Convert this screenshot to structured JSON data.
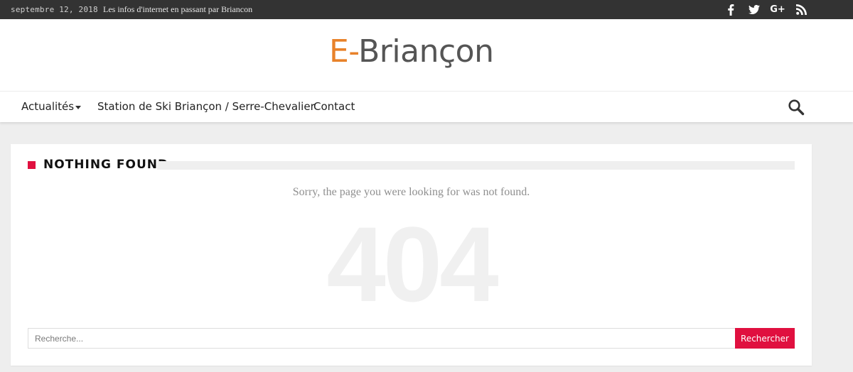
{
  "topbar": {
    "date": "septembre 12, 2018",
    "tagline": "Les infos d'internet en passant par Briancon",
    "social": [
      "facebook-icon",
      "twitter-icon",
      "google-plus-icon",
      "rss-icon"
    ],
    "google_plus_label": "G+"
  },
  "header": {
    "logo_prefix": "E-",
    "logo_name": "Briançon"
  },
  "nav": {
    "items": [
      {
        "label": "Actualités",
        "has_dropdown": true
      },
      {
        "label": "Station de Ski Briançon / Serre-Chevalier"
      },
      {
        "label": "Contact"
      }
    ],
    "search_icon": "search-icon"
  },
  "content": {
    "heading": "NOTHING FOUND",
    "message": "Sorry, the page you were looking for was not found.",
    "error_code": "404",
    "search": {
      "placeholder": "Recherche...",
      "value": "",
      "button_label": "Rechercher"
    }
  },
  "colors": {
    "accent": "#e0103f",
    "topbar_bg": "#333333",
    "logo_orange": "#e8822a",
    "logo_grey": "#555555",
    "page_bg": "#eeeeee"
  }
}
